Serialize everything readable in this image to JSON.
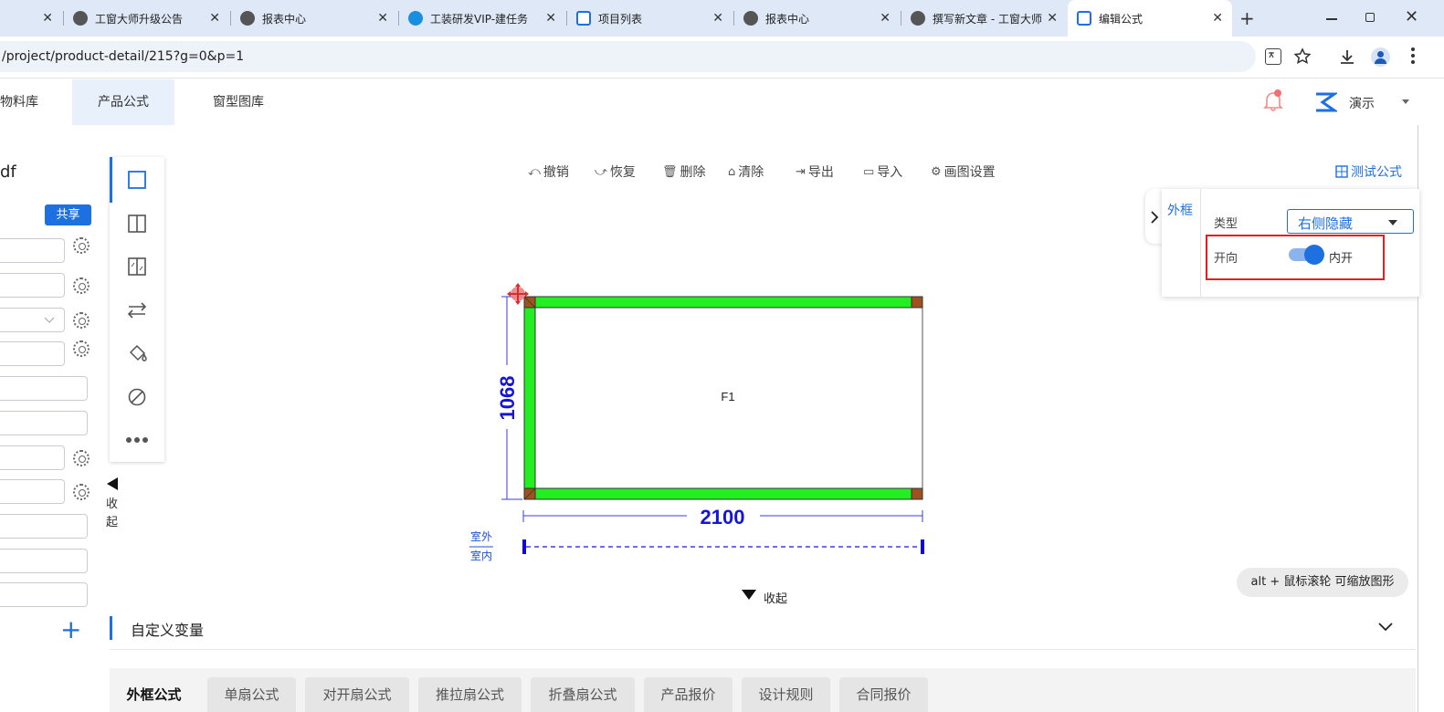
{
  "browser": {
    "tabs": [
      {
        "title": "",
        "active": false
      },
      {
        "title": "工窗大师升级公告",
        "active": false
      },
      {
        "title": "报表中心",
        "active": false
      },
      {
        "title": "工装研发VIP-建任务",
        "active": false
      },
      {
        "title": "项目列表",
        "active": false
      },
      {
        "title": "报表中心",
        "active": false
      },
      {
        "title": "撰写新文章 - 工窗大师",
        "active": false
      },
      {
        "title": "编辑公式",
        "active": true
      }
    ],
    "new_tab": "+",
    "close_glyph": "✕",
    "url": "/project/product-detail/215?g=0&p=1"
  },
  "nav": {
    "items": [
      "物料库",
      "产品公式",
      "窗型图库"
    ],
    "active": "产品公式",
    "user": "演示"
  },
  "left": {
    "title": "df",
    "share": "共享",
    "add": "+"
  },
  "collapse_side": {
    "label1": "收",
    "label2": "起"
  },
  "toolbar": {
    "undo": "撤销",
    "redo": "恢复",
    "delete": "删除",
    "clear": "清除",
    "export": "导出",
    "import": "导入",
    "settings": "画图设置",
    "test": "测试公式"
  },
  "drawing": {
    "width_label": "2100",
    "height_label": "1068",
    "cell_label": "F1",
    "outside": "室外",
    "inside": "室内",
    "frame_color": "#22ee22",
    "corner_color": "#a0521e"
  },
  "panel": {
    "tab": "外框",
    "type_label": "类型",
    "type_value": "右侧隐藏",
    "dir_label": "开向",
    "dir_value": "内开",
    "toggle_on": true
  },
  "hint": "alt + 鼠标滚轮 可缩放图形",
  "collapse_bottom": "收起",
  "custom_var": "自定义变量",
  "bottom_tabs": [
    "外框公式",
    "单扇公式",
    "对开扇公式",
    "推拉扇公式",
    "折叠扇公式",
    "产品报价",
    "设计规则",
    "合同报价"
  ],
  "accent": "#1e6fe0",
  "highlight": "#e02020"
}
